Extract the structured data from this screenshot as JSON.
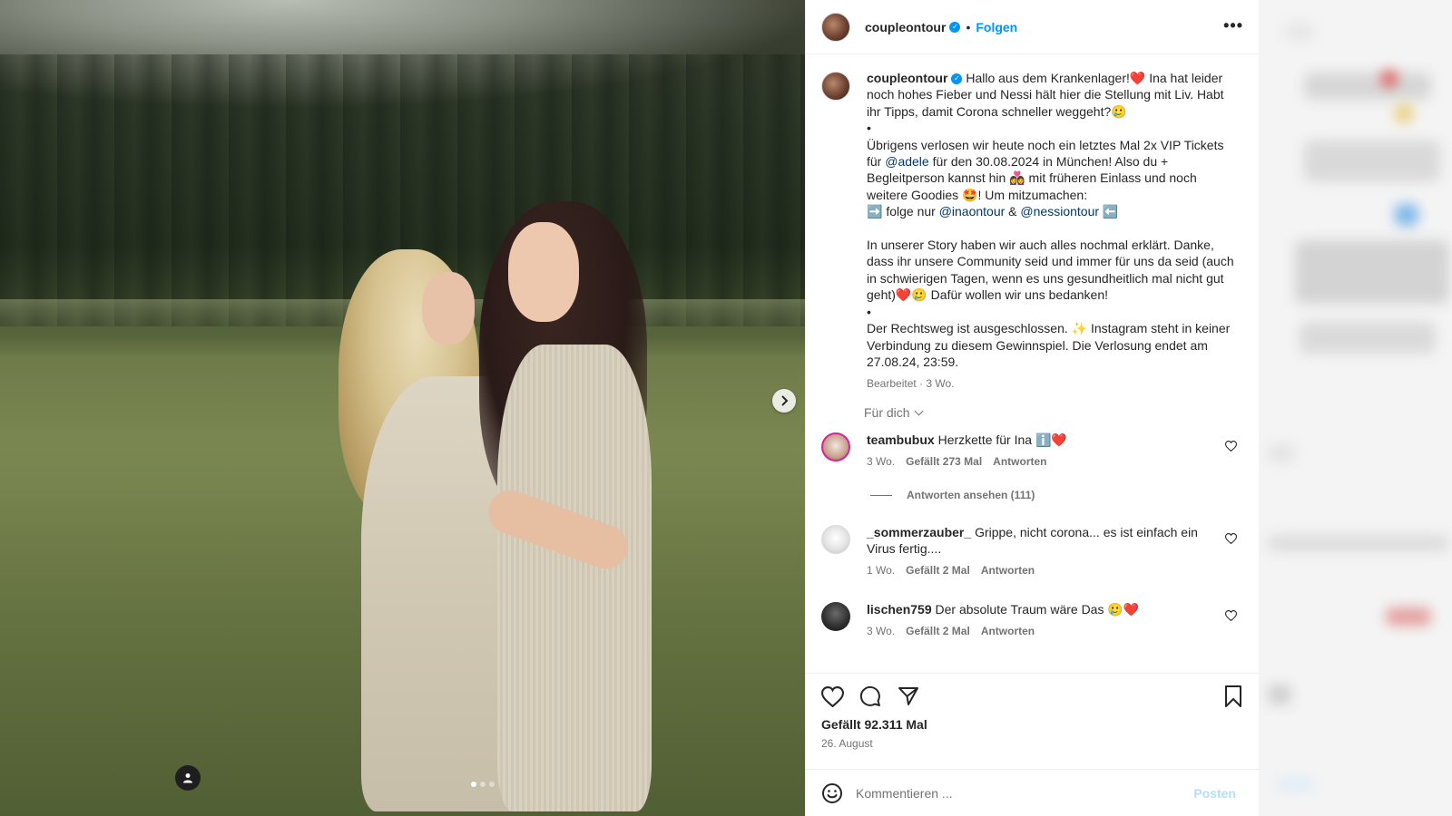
{
  "post": {
    "username": "coupleontour",
    "follow_label": "Folgen",
    "dot": "•",
    "more": "•••",
    "edited_time": "Bearbeitet · 3 Wo.",
    "for_you": "Für dich",
    "likes": "Gefällt 92.311 Mal",
    "date": "26. August",
    "verified_glyph": "✓"
  },
  "caption": {
    "p1a": "Hallo aus dem Krankenlager!",
    "p1b": " Ina hat leider noch hohes Fieber und Nessi hält hier die Stellung mit Liv. Habt ihr Tipps, damit Corona schneller weggeht?",
    "p2": "•",
    "p3a": "Übrigens verlosen wir heute noch ein letztes Mal 2x VIP Tickets für ",
    "mention_adele": "@adele",
    "p3b": " für den 30.08.2024 in München! Also du + Begleitperson kannst hin ",
    "p3c": " mit früheren Einlass und noch weitere Goodies ",
    "p3d": "! Um mitzumachen:",
    "p4a": " folge nur ",
    "mention_ina": "@inaontour",
    "amp": " & ",
    "mention_nessi": "@nessiontour",
    "p5": "In unserer Story haben wir auch alles nochmal erklärt. Danke, dass ihr unsere Community seid und immer für uns da seid (auch in schwierigen Tagen, wenn es uns gesundheitlich mal nicht gut geht)",
    "p5b": " Dafür wollen wir uns bedanken!",
    "p6": "•",
    "p7a": "Der Rechtsweg ist ausgeschlossen. ",
    "p7b": " Instagram steht in keiner Verbindung zu diesem Gewinnspiel. Die Verlosung endet am 27.08.24, 23:59."
  },
  "emoji": {
    "heart": "❤️",
    "smile": "🥲",
    "star_eyes": "🤩",
    "arrow_right": "➡️",
    "arrow_left": "⬅️",
    "sparkle": "✨",
    "boxes": "👩‍❤️‍👩",
    "info": "ℹ️"
  },
  "comments": [
    {
      "user": "teambubux",
      "text": "Herzkette für Ina ",
      "time": "3 Wo.",
      "likes": "Gefällt 273 Mal",
      "reply": "Antworten"
    },
    {
      "user": "_sommerzauber_",
      "text": "Grippe, nicht corona... es ist einfach ein Virus fertig....",
      "time": "1 Wo.",
      "likes": "Gefällt 2 Mal",
      "reply": "Antworten"
    },
    {
      "user": "lischen759",
      "text": "Der absolute Traum wäre Das ",
      "time": "3 Wo.",
      "likes": "Gefällt 2 Mal",
      "reply": "Antworten"
    }
  ],
  "replies_label": "Antworten ansehen (111)",
  "composer": {
    "placeholder": "Kommentieren ...",
    "post_label": "Posten"
  },
  "icons": {
    "heart": "heart-icon",
    "comment": "comment-icon",
    "share": "share-icon",
    "bookmark": "bookmark-icon",
    "emoji": "emoji-icon",
    "next": "chevron-right-icon",
    "tag": "user-tag-icon"
  },
  "colors": {
    "accent": "#0095f6",
    "mention": "#00376b",
    "secondary_text": "#737373"
  }
}
